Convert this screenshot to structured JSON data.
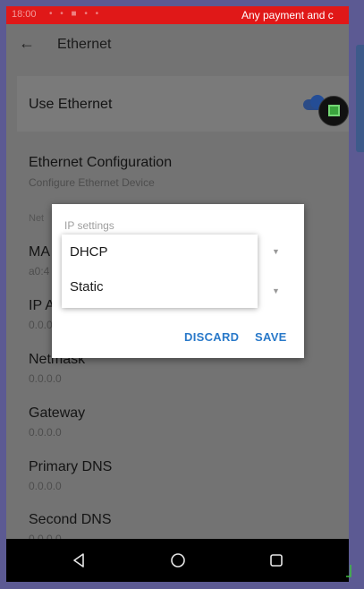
{
  "status_bar": {
    "time": "18:00",
    "indicators": "• • ■ • •",
    "banner": "Any payment and c"
  },
  "app_bar": {
    "back_icon": "arrow-back-icon",
    "title": "Ethernet"
  },
  "settings": {
    "use_ethernet": {
      "title": "Use Ethernet",
      "toggle_on": true
    },
    "configuration": {
      "title": "Ethernet Configuration",
      "subtitle": "Configure Ethernet Device"
    },
    "section_header": "Net",
    "mac": {
      "title": "MA",
      "subtitle": "a0:4"
    },
    "ip": {
      "title": "IP A",
      "subtitle": "0.0.0"
    },
    "netmask": {
      "title": "Netmask",
      "subtitle": "0.0.0.0"
    },
    "gateway": {
      "title": "Gateway",
      "subtitle": "0.0.0.0"
    },
    "primary_dns": {
      "title": "Primary DNS",
      "subtitle": "0.0.0.0"
    },
    "second_dns": {
      "title": "Second DNS",
      "subtitle": "0.0.0.0"
    }
  },
  "dialog": {
    "label": "IP settings",
    "options": [
      "DHCP",
      "Static"
    ],
    "discard_label": "DISCARD",
    "save_label": "SAVE"
  },
  "nav_bar": {
    "back_icon": "nav-back-icon",
    "home_icon": "nav-home-icon",
    "recents_icon": "nav-recents-icon"
  },
  "colors": {
    "status_bar": "#e01818",
    "accent": "#2979c9",
    "toggle": "#244d96",
    "fab_icon": "#3aa43d"
  }
}
